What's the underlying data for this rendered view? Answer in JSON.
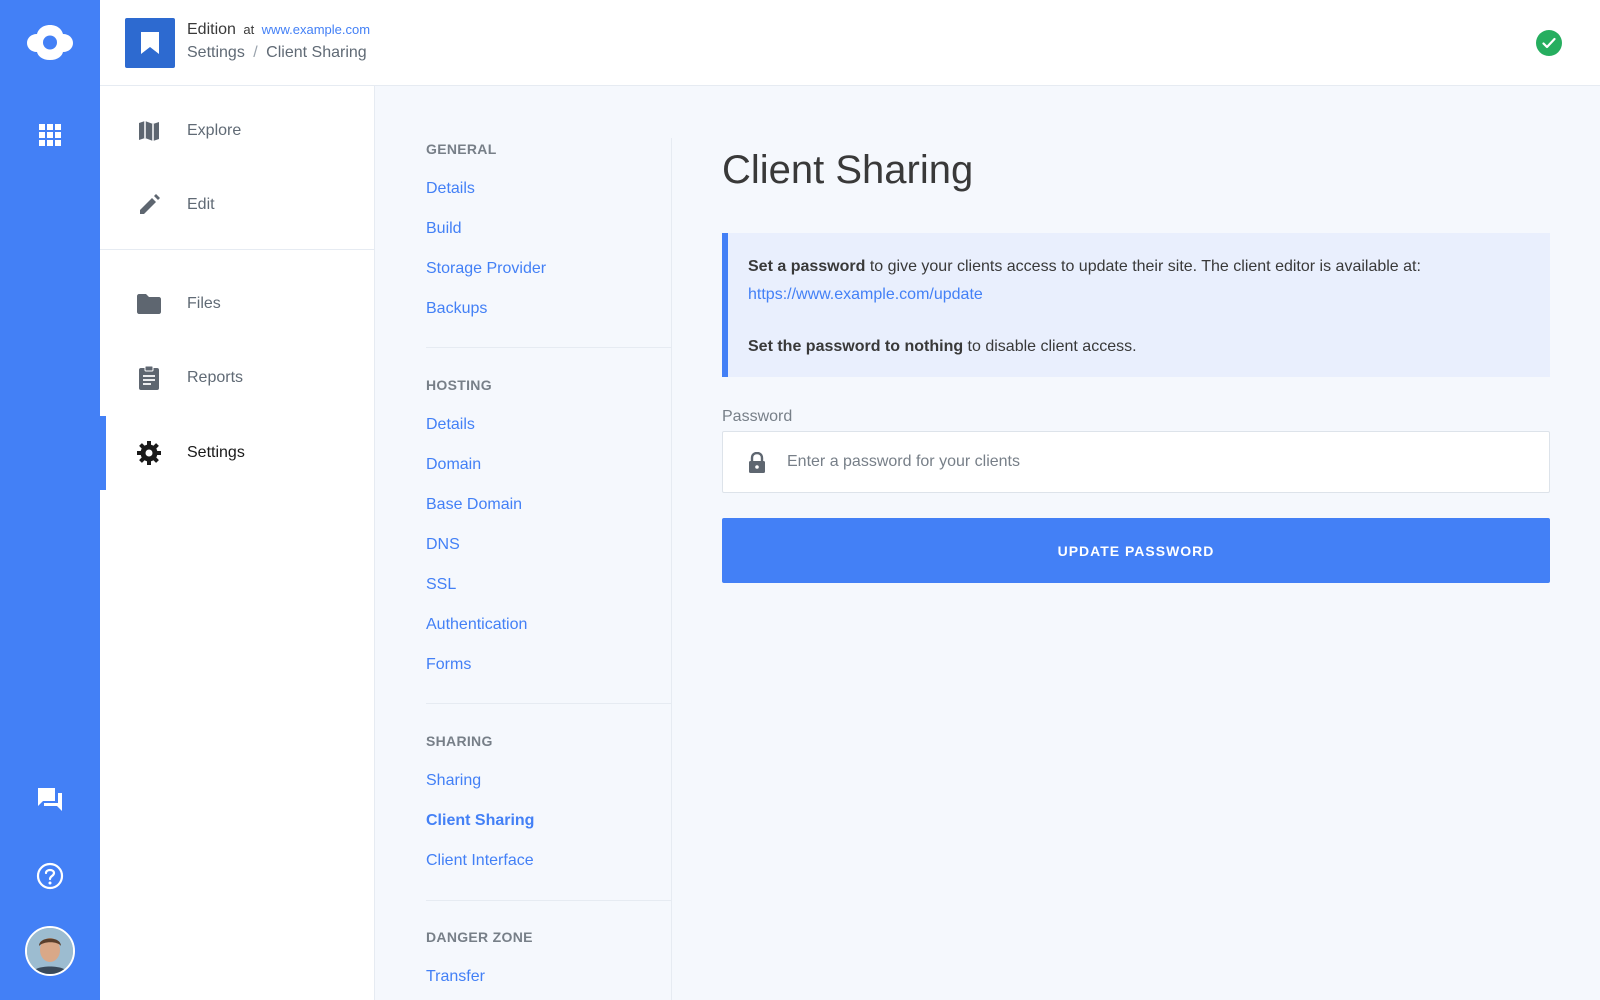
{
  "colors": {
    "accent": "#4380f6",
    "success": "#26ae5f",
    "site_badge": "#2d6ad0"
  },
  "rail": {
    "logo_icon": "cloudcannon-logo-icon",
    "apps_icon": "grid-apps-icon",
    "chat_icon": "chat-bubbles-icon",
    "help_icon": "help-circle-icon",
    "avatar": "user-avatar"
  },
  "header": {
    "site_name": "Edition",
    "at": "at",
    "site_url": "www.example.com",
    "breadcrumb_parent": "Settings",
    "breadcrumb_sep": "/",
    "breadcrumb_current": "Client Sharing",
    "status_icon": "check-circle-icon"
  },
  "nav": {
    "items": [
      {
        "label": "Explore",
        "icon": "map-icon"
      },
      {
        "label": "Edit",
        "icon": "pencil-icon"
      },
      {
        "label": "Files",
        "icon": "folder-icon"
      },
      {
        "label": "Reports",
        "icon": "clipboard-icon"
      },
      {
        "label": "Settings",
        "icon": "gear-icon",
        "active": true
      }
    ]
  },
  "subnav": {
    "general": {
      "heading": "GENERAL",
      "links": [
        "Details",
        "Build",
        "Storage Provider",
        "Backups"
      ]
    },
    "hosting": {
      "heading": "HOSTING",
      "links": [
        "Details",
        "Domain",
        "Base Domain",
        "DNS",
        "SSL",
        "Authentication",
        "Forms"
      ]
    },
    "sharing": {
      "heading": "SHARING",
      "links": [
        "Sharing",
        "Client Sharing",
        "Client Interface"
      ],
      "active": "Client Sharing"
    },
    "danger": {
      "heading": "DANGER ZONE",
      "links": [
        "Transfer"
      ]
    }
  },
  "content": {
    "title": "Client Sharing",
    "info": {
      "line1_bold": "Set a password",
      "line1_rest": " to give your clients access to update their site. The client editor is available at:",
      "link": "https://www.example.com/update",
      "line2_bold": "Set the password to nothing",
      "line2_rest": " to disable client access."
    },
    "password_label": "Password",
    "password_placeholder": "Enter a password for your clients",
    "password_value": "",
    "update_button": "UPDATE PASSWORD"
  }
}
